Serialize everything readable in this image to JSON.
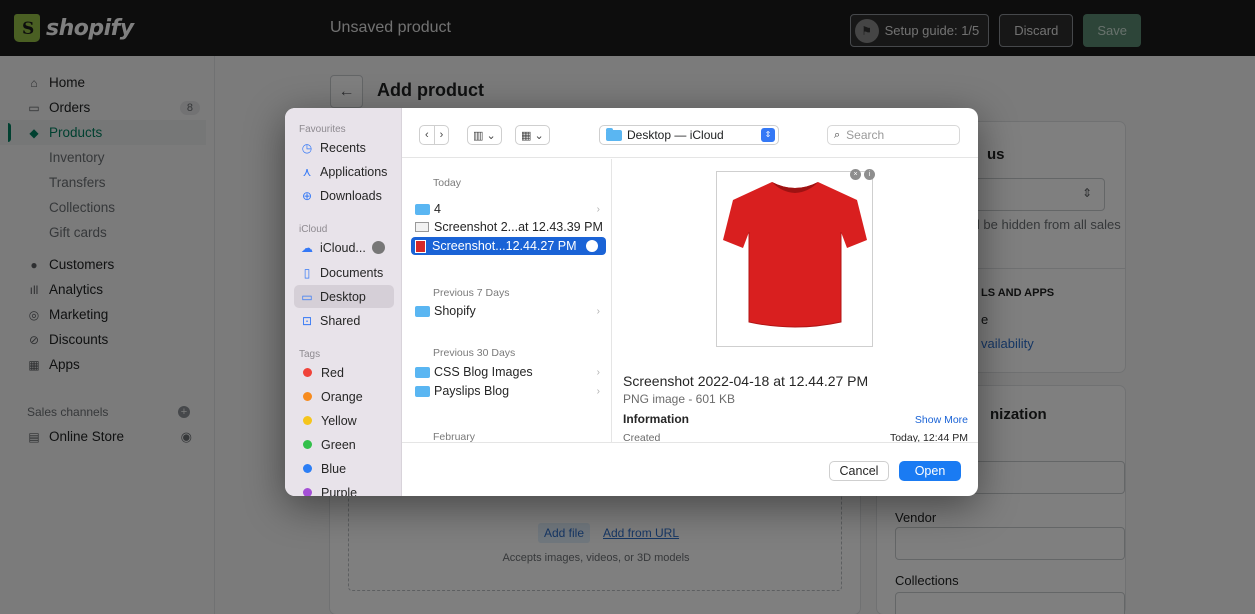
{
  "topbar": {
    "logo_text": "shopify",
    "page_status": "Unsaved product",
    "setup_label": "Setup guide: 1/5",
    "discard_label": "Discard",
    "save_label": "Save"
  },
  "sidebar": {
    "home": "Home",
    "orders": "Orders",
    "orders_badge": "8",
    "products": "Products",
    "sub": [
      "Inventory",
      "Transfers",
      "Collections",
      "Gift cards"
    ],
    "customers": "Customers",
    "analytics": "Analytics",
    "marketing": "Marketing",
    "discounts": "Discounts",
    "apps": "Apps",
    "sales_channels": "Sales channels",
    "online_store": "Online Store"
  },
  "main": {
    "title": "Add product",
    "add_file": "Add file",
    "add_url": "Add from URL",
    "accepts": "Accepts images, videos, or 3D models",
    "status_title_fragment": "us",
    "status_note_fragment": "ll be hidden from all sales",
    "sales_apps_fragment": "LS AND APPS",
    "sales_e_fragment": "e",
    "availability_fragment": "vailability",
    "org_title_fragment": "nization",
    "vendor_label": "Vendor",
    "collections_label": "Collections"
  },
  "dialog": {
    "sidebar": {
      "favourites_label": "Favourites",
      "recents": "Recents",
      "applications": "Applications",
      "downloads": "Downloads",
      "icloud_label": "iCloud",
      "icloud_drive": "iCloud...",
      "documents": "Documents",
      "desktop": "Desktop",
      "shared": "Shared",
      "tags_label": "Tags",
      "tags": [
        "Red",
        "Orange",
        "Yellow",
        "Green",
        "Blue",
        "Purple"
      ],
      "tag_colors": [
        "#f0433a",
        "#f78b1e",
        "#f5c51c",
        "#33c04b",
        "#2c7ef5",
        "#a44fd6"
      ]
    },
    "toolbar": {
      "location": "Desktop — iCloud",
      "search_placeholder": "Search"
    },
    "list": {
      "today_label": "Today",
      "today": [
        "4",
        "Screenshot 2...at 12.43.39 PM",
        "Screenshot...12.44.27 PM"
      ],
      "prev7_label": "Previous 7 Days",
      "prev7": [
        "Shopify"
      ],
      "prev30_label": "Previous 30 Days",
      "prev30": [
        "CSS Blog Images",
        "Payslips Blog"
      ],
      "february_label": "February"
    },
    "preview": {
      "file_name": "Screenshot 2022-04-18 at 12.44.27 PM",
      "file_type": "PNG image - 601 KB",
      "information": "Information",
      "show_more": "Show More",
      "created_label": "Created",
      "created_value": "Today, 12:44 PM"
    },
    "footer": {
      "cancel": "Cancel",
      "open": "Open"
    }
  }
}
